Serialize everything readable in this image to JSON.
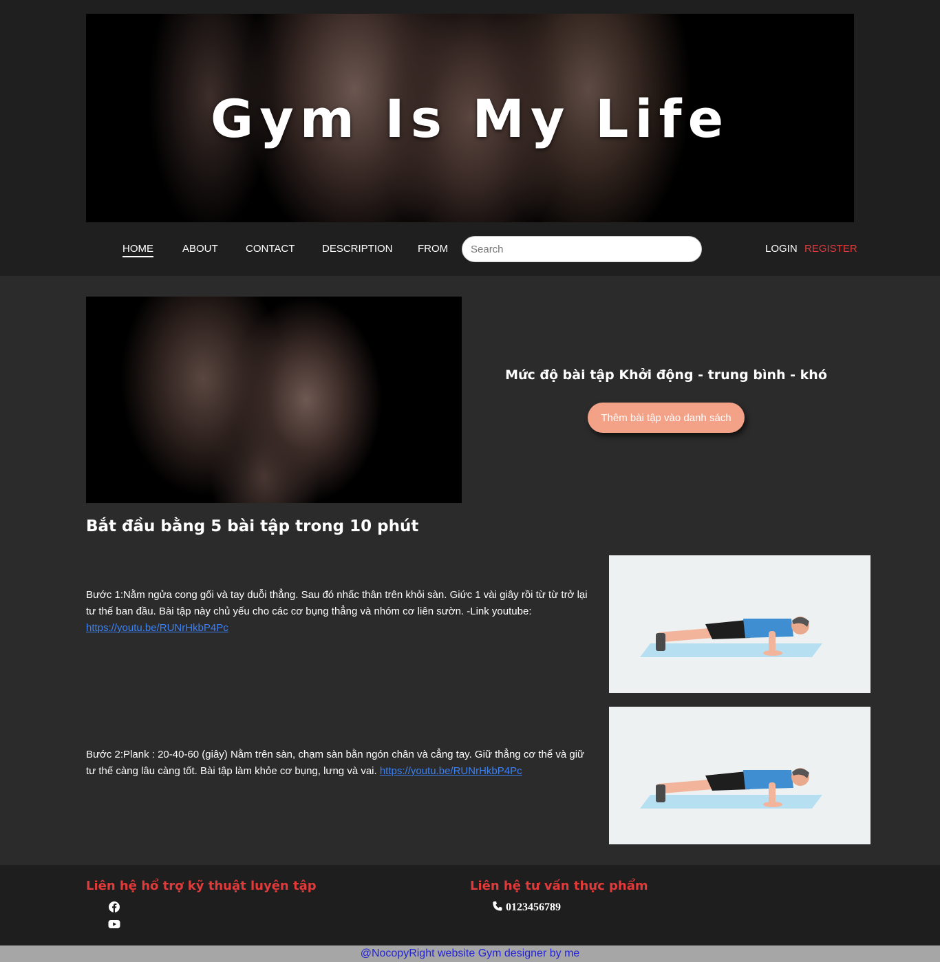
{
  "banner": {
    "title": "Gym Is My Life"
  },
  "nav": {
    "items": [
      {
        "label": "HOME"
      },
      {
        "label": "ABOUT"
      },
      {
        "label": "CONTACT"
      },
      {
        "label": "DESCRIPTION"
      },
      {
        "label": "FROM"
      }
    ],
    "search_placeholder": "Search",
    "login": "LOGIN",
    "register": "REGISTER"
  },
  "main": {
    "level_text": "Mức độ bài tập Khởi động - trung bình - khó",
    "add_button": "Thêm bài tập vào danh sách",
    "section_title": "Bắt đầu bằng 5 bài tập trong 10 phút",
    "steps": [
      {
        "text": "Bước 1:Nằm ngửa cong gối và tay duỗi thẳng. Sau đó nhấc thân trên khỏi sàn. Giức 1 vài giây rồi từ từ trở lại tư thế ban đầu. Bài tập này chủ yếu cho các cơ bụng thẳng và nhóm cơ liên sườn. -Link youtube: ",
        "link": "https://youtu.be/RUNrHkbP4Pc"
      },
      {
        "text": "Bước 2:Plank : 20-40-60 (giây) Nằm trên sàn, chạm sàn bằn ngón chân và cẳng tay. Giữ thẳng cơ thể và giữ tư thế càng lâu càng tốt. Bài tập làm khỏe cơ bụng, lưng và vai. ",
        "link": "https://youtu.be/RUNrHkbP4Pc"
      }
    ]
  },
  "footer": {
    "support_title": "Liên hệ hổ trợ kỹ thuật luyện tập",
    "food_title": "Liên hệ tư vấn thực phẩm",
    "phone": "0123456789",
    "icons": [
      "facebook-icon",
      "youtube-icon",
      "phone-icon"
    ]
  },
  "copyright": "@NocopyRight website Gym designer by me",
  "colors": {
    "accent_red": "#e03a3a",
    "button_peach": "#f4a287",
    "link_blue": "#3b82f6"
  }
}
